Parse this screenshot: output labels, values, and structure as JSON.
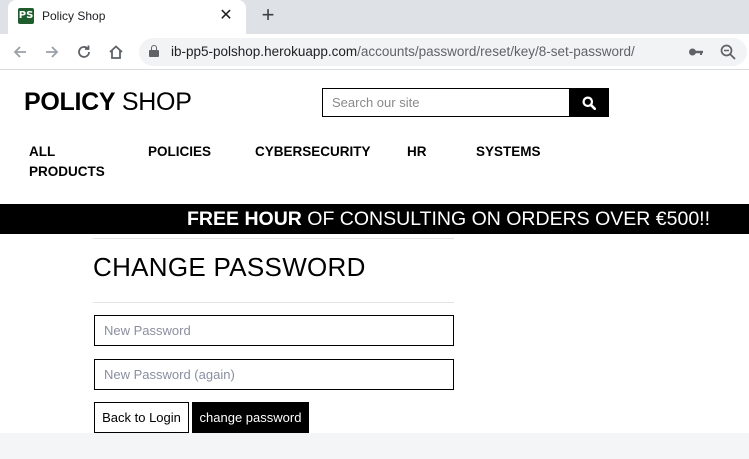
{
  "browser": {
    "tab_title": "Policy Shop",
    "favicon_text": "PS",
    "url_domain": "ib-pp5-polshop.herokuapp.com",
    "url_path": "/accounts/password/reset/key/8-set-password/"
  },
  "site": {
    "logo_bold": "POLICY",
    "logo_light": " SHOP",
    "search_placeholder": "Search our site",
    "nav": {
      "all_line1": "ALL",
      "all_line2": "PRODUCTS",
      "policies": "POLICIES",
      "cybersecurity": "CYBERSECURITY",
      "hr": "HR",
      "systems": "SYSTEMS"
    },
    "banner_bold": "FREE HOUR",
    "banner_rest": " OF CONSULTING ON ORDERS OVER €500!!"
  },
  "form": {
    "heading": "CHANGE PASSWORD",
    "password_placeholder": "New Password",
    "password2_placeholder": "New Password (again)",
    "back_label": "Back to Login",
    "submit_label": "change password"
  },
  "icons": [
    "back-arrow-icon",
    "forward-arrow-icon",
    "reload-icon",
    "home-icon",
    "lock-icon",
    "key-icon",
    "zoom-icon",
    "search-icon",
    "close-icon",
    "plus-icon"
  ],
  "colors": {
    "accent": "#000000",
    "banner_text": "#ffffff",
    "favicon": "#1f5c2e"
  }
}
